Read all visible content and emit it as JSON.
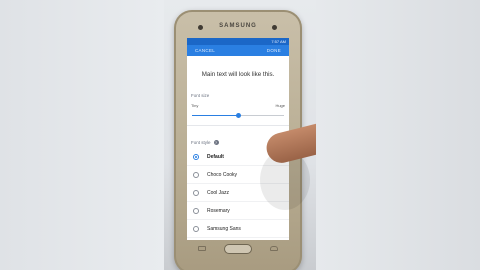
{
  "device": {
    "brand": "SAMSUNG"
  },
  "status_bar": {
    "time": "7:57 AM"
  },
  "action_bar": {
    "cancel_label": "CANCEL",
    "done_label": "DONE"
  },
  "preview": {
    "text": "Main text will look like this."
  },
  "font_size": {
    "label": "Font size",
    "min_label": "Tiny",
    "max_label": "Huge",
    "level": 0.5
  },
  "font_style": {
    "label": "Font style",
    "selected": "Default",
    "options": [
      "Default",
      "Choco Cooky",
      "Cool Jazz",
      "Rosemary",
      "Samsung Sans"
    ]
  },
  "colors": {
    "accent": "#2a7fe2",
    "status_bar": "#1b67c7"
  }
}
